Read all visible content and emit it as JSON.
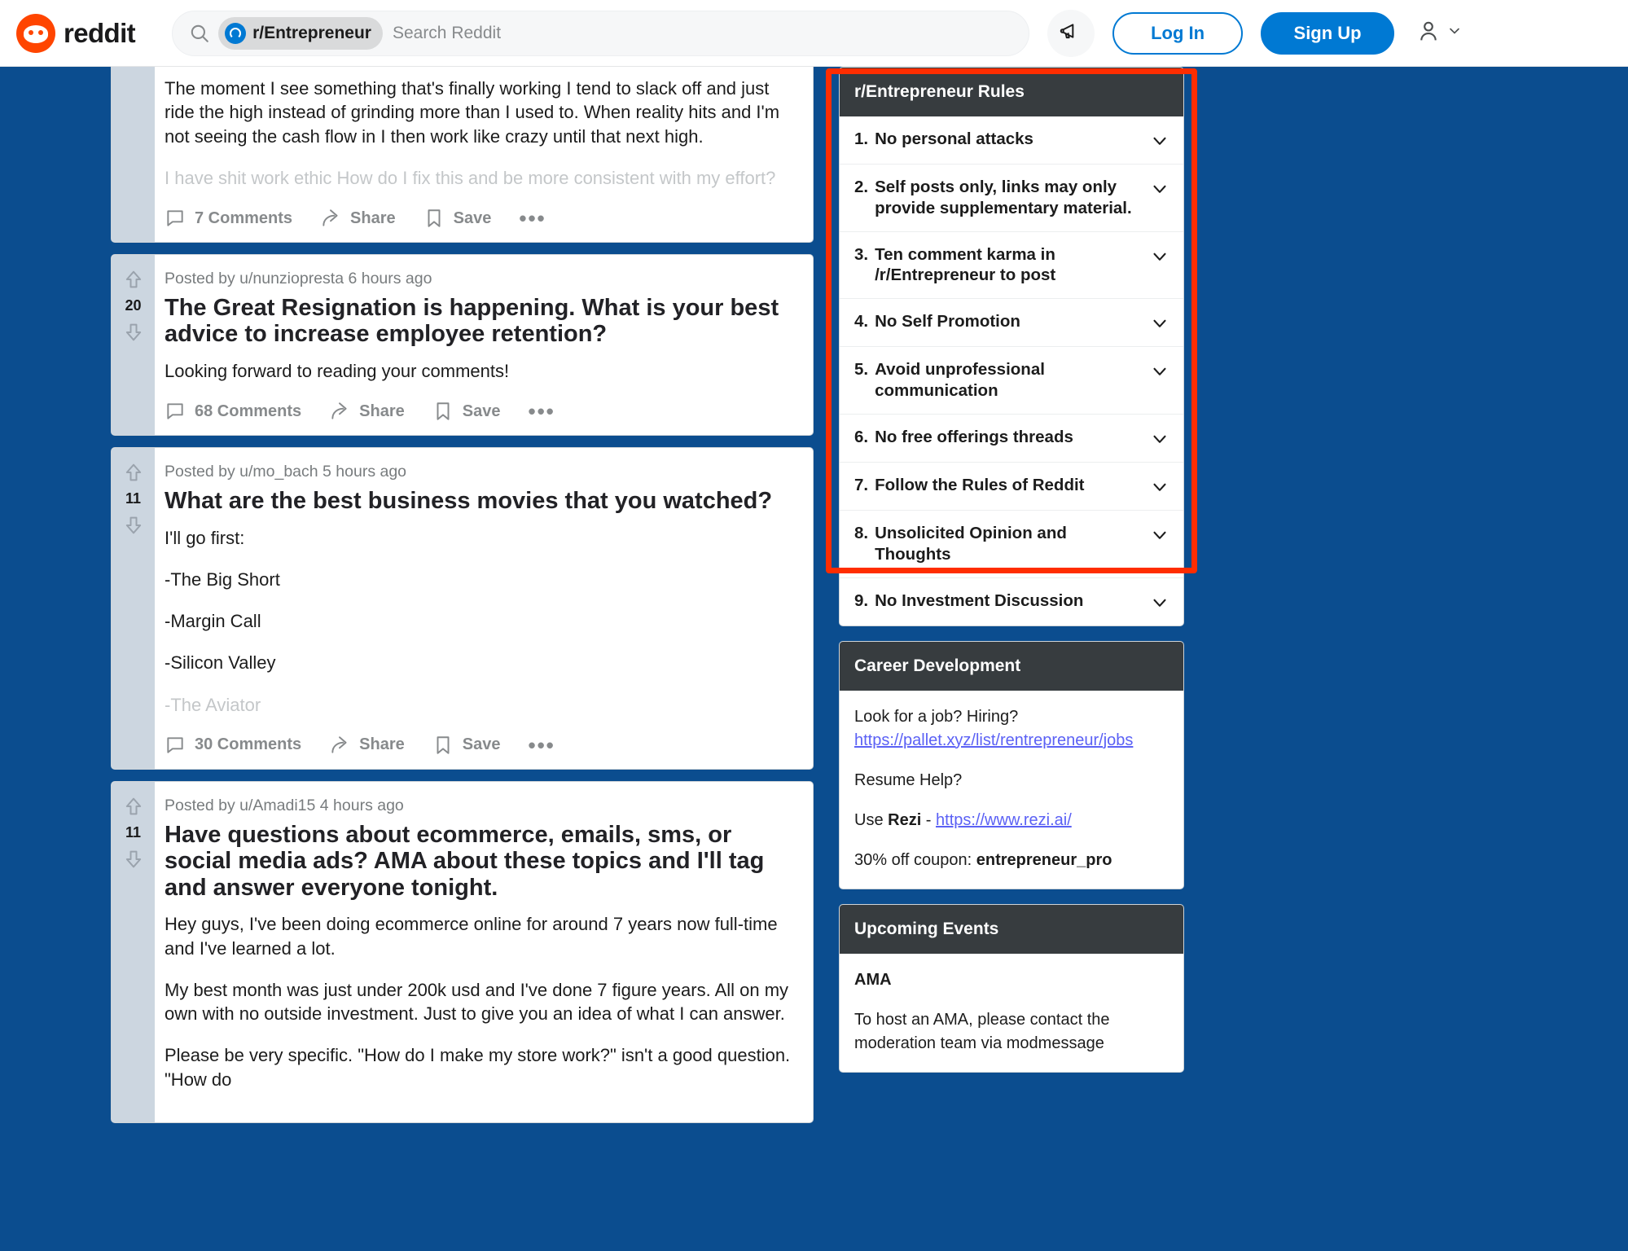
{
  "nav": {
    "brand": "reddit",
    "search": {
      "chip": "r/Entrepreneur",
      "placeholder": "Search Reddit",
      "value": ""
    },
    "announcement_icon": "megaphone-icon",
    "login": "Log In",
    "signup": "Sign Up",
    "account_icon": "user-avatar-icon"
  },
  "feed": [
    {
      "votes": "",
      "meta": "",
      "title": "",
      "body": [
        "The moment I see something that's finally working I tend to slack off and just ride the high instead of grinding more than I used to. When reality hits and I'm not seeing the cash flow in I then work like crazy until that next high.",
        "I have shit work ethic How do I fix this and be more consistent with my effort?"
      ],
      "faded_from": 1,
      "comments": "7 Comments",
      "share": "Share",
      "save": "Save",
      "more": "•••"
    },
    {
      "votes": "20",
      "meta": "Posted by u/nunziopresta 6 hours ago",
      "title": "The Great Resignation is happening. What is your best advice to increase employee retention?",
      "body": [
        "Looking forward to reading your comments!"
      ],
      "faded_from": 99,
      "comments": "68 Comments",
      "share": "Share",
      "save": "Save",
      "more": "•••"
    },
    {
      "votes": "11",
      "meta": "Posted by u/mo_bach 5 hours ago",
      "title": "What are the best business movies that you watched?",
      "body": [
        "I'll go first:",
        "-The Big Short",
        "-Margin Call",
        "-Silicon Valley",
        "-The Aviator"
      ],
      "faded_from": 4,
      "comments": "30 Comments",
      "share": "Share",
      "save": "Save",
      "more": "•••"
    },
    {
      "votes": "11",
      "meta": "Posted by u/Amadi15 4 hours ago",
      "title": "Have questions about ecommerce, emails, sms, or social media ads? AMA about these topics and I'll tag and answer everyone tonight.",
      "body": [
        "Hey guys, I've been doing ecommerce online for around 7 years now full-time and I've learned a lot.",
        "My best month was just under 200k usd and I've done 7 figure years. All on my own with no outside investment. Just to give you an idea of what I can answer.",
        "Please be very specific. \"How do I make my store work?\" isn't a good question. \"How do"
      ],
      "faded_from": 99,
      "comments": "",
      "share": "",
      "save": "",
      "more": ""
    }
  ],
  "sidebar": {
    "rules": {
      "title": "r/Entrepreneur Rules",
      "items": [
        {
          "num": "1.",
          "text": "No personal attacks"
        },
        {
          "num": "2.",
          "text": "Self posts only, links may only provide supplementary material."
        },
        {
          "num": "3.",
          "text": "Ten comment karma in /r/Entrepreneur to post"
        },
        {
          "num": "4.",
          "text": "No Self Promotion"
        },
        {
          "num": "5.",
          "text": "Avoid unprofessional communication"
        },
        {
          "num": "6.",
          "text": "No free offerings threads"
        },
        {
          "num": "7.",
          "text": "Follow the Rules of Reddit"
        },
        {
          "num": "8.",
          "text": "Unsolicited Opinion and Thoughts"
        },
        {
          "num": "9.",
          "text": "No Investment Discussion"
        }
      ]
    },
    "career": {
      "title": "Career Development",
      "line1": "Look for a job? Hiring?",
      "jobs_link": "https://pallet.xyz/list/rentrepreneur/jobs",
      "line2": "Resume Help?",
      "use_prefix": "Use ",
      "use_bold": "Rezi",
      "use_sep": " - ",
      "rezi_link": "https://www.rezi.ai/",
      "coupon_prefix": "30% off coupon: ",
      "coupon_code": "entrepreneur_pro"
    },
    "events": {
      "title": "Upcoming Events",
      "item_title": "AMA",
      "item_text": "To host an AMA, please contact the moderation team via modmessage"
    }
  },
  "colors": {
    "accent": "#0079d3",
    "brand": "#ff4500",
    "page_bg": "#0b4d8f",
    "widget_head": "#373c3f",
    "highlight": "#ff2d00",
    "link": "#5b61f5"
  }
}
